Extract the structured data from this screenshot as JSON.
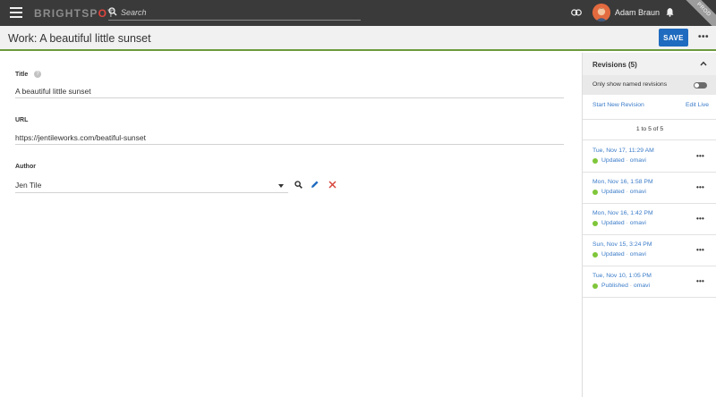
{
  "topbar": {
    "logo_a": "BRIGHTSP",
    "logo_b": "O",
    "logo_c": "T",
    "search_placeholder": "Search",
    "user_name": "Adam Braun",
    "env_badge": "PROD"
  },
  "titlebar": {
    "title": "Work: A beautiful little sunset",
    "save_label": "SAVE",
    "more_label": "•••"
  },
  "form": {
    "title_label": "Title",
    "title_value": "A beautiful little sunset",
    "url_label": "URL",
    "url_value": "https://jentileworks.com/beatiful-sunset",
    "author_label": "Author",
    "author_value": "Jen Tile"
  },
  "sidebar": {
    "title": "Revisions (5)",
    "toggle_label": "Only show named revisions",
    "toggle_on": false,
    "start_new": "Start New Revision",
    "edit_live": "Edit Live",
    "range": "1 to 5 of 5",
    "revisions": [
      {
        "date": "Tue, Nov 17, 11:29 AM",
        "status": "Updated",
        "sep": " · ",
        "user": "omavi"
      },
      {
        "date": "Mon, Nov 16, 1:58 PM",
        "status": "Updated",
        "sep": " · ",
        "user": "omavi"
      },
      {
        "date": "Mon, Nov 16, 1:42 PM",
        "status": "Updated",
        "sep": " · ",
        "user": "omavi"
      },
      {
        "date": "Sun, Nov 15, 3:24 PM",
        "status": "Updated",
        "sep": " · ",
        "user": "omavi"
      },
      {
        "date": "Tue, Nov 10, 1:05 PM",
        "status": "Published",
        "sep": " · ",
        "user": "omavi"
      }
    ],
    "more_label": "•••"
  },
  "colors": {
    "topbar": "#3a3a3a",
    "accent_blue": "#1f6bbf",
    "link_blue": "#3a7bc8",
    "status_green": "#7fc63a",
    "brand_red": "#e0453e",
    "title_underline": "#6c9a3a"
  }
}
